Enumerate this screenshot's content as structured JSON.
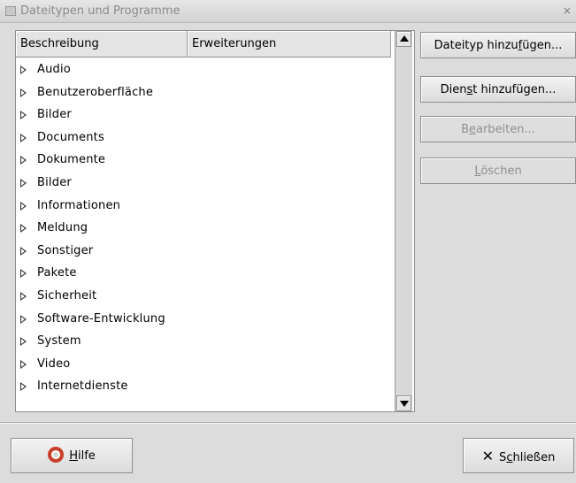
{
  "window": {
    "title": "Dateitypen und Programme",
    "close_glyph": "×"
  },
  "list": {
    "columns": [
      "Beschreibung",
      "Erweiterungen"
    ],
    "rows": [
      "Audio",
      "Benutzeroberfläche",
      "Bilder",
      "Documents",
      "Dokumente",
      "Bilder",
      "Informationen",
      "Meldung",
      "Sonstiger",
      "Pakete",
      "Sicherheit",
      "Software-Entwicklung",
      "System",
      "Video",
      "Internetdienste"
    ]
  },
  "buttons": {
    "add_type": {
      "pre": "Dateityp hinzu",
      "key": "f",
      "post": "ügen..."
    },
    "add_service": {
      "pre": "Dien",
      "key": "s",
      "post": "t hinzufügen..."
    },
    "edit": {
      "pre": "B",
      "key": "e",
      "post": "arbeiten..."
    },
    "delete": {
      "pre": "",
      "key": "L",
      "post": "öschen"
    },
    "help": {
      "pre": "",
      "key": "H",
      "post": "ilfe"
    },
    "close": {
      "pre": "S",
      "key": "c",
      "post": "hließen"
    }
  },
  "icons": {
    "help": "lifebuoy-icon",
    "close": "close-x-icon",
    "expander": "expander-triangle-icon"
  }
}
